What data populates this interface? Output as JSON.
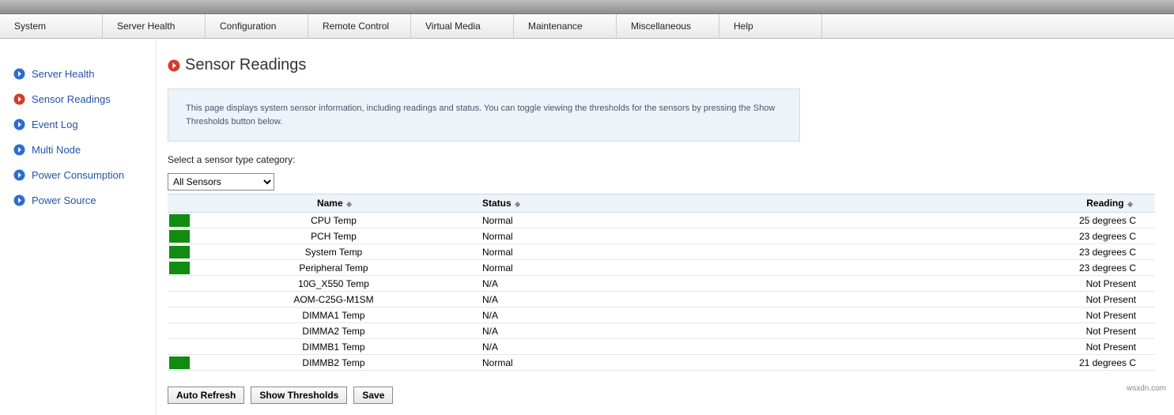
{
  "menubar": {
    "items": [
      {
        "label": "System"
      },
      {
        "label": "Server Health"
      },
      {
        "label": "Configuration"
      },
      {
        "label": "Remote Control"
      },
      {
        "label": "Virtual Media"
      },
      {
        "label": "Maintenance"
      },
      {
        "label": "Miscellaneous"
      },
      {
        "label": "Help"
      }
    ]
  },
  "sidebar": {
    "items": [
      {
        "label": "Server Health",
        "active": false
      },
      {
        "label": "Sensor Readings",
        "active": true
      },
      {
        "label": "Event Log",
        "active": false
      },
      {
        "label": "Multi Node",
        "active": false
      },
      {
        "label": "Power Consumption",
        "active": false
      },
      {
        "label": "Power Source",
        "active": false
      }
    ]
  },
  "page": {
    "title": "Sensor Readings",
    "info_text": "This page displays system sensor information, including readings and status. You can toggle viewing the thresholds for the sensors by pressing the Show Thresholds button below.",
    "select_label": "Select a sensor type category:",
    "select_value": "All Sensors"
  },
  "table": {
    "headers": {
      "name": "Name",
      "status": "Status",
      "reading": "Reading"
    },
    "rows": [
      {
        "swatch": "green",
        "name": "CPU Temp",
        "status": "Normal",
        "reading": "25 degrees C"
      },
      {
        "swatch": "green",
        "name": "PCH Temp",
        "status": "Normal",
        "reading": "23 degrees C"
      },
      {
        "swatch": "green",
        "name": "System Temp",
        "status": "Normal",
        "reading": "23 degrees C"
      },
      {
        "swatch": "green",
        "name": "Peripheral Temp",
        "status": "Normal",
        "reading": "23 degrees C"
      },
      {
        "swatch": "",
        "name": "10G_X550 Temp",
        "status": "N/A",
        "reading": "Not Present"
      },
      {
        "swatch": "",
        "name": "AOM-C25G-M1SM",
        "status": "N/A",
        "reading": "Not Present"
      },
      {
        "swatch": "",
        "name": "DIMMA1 Temp",
        "status": "N/A",
        "reading": "Not Present"
      },
      {
        "swatch": "",
        "name": "DIMMA2 Temp",
        "status": "N/A",
        "reading": "Not Present"
      },
      {
        "swatch": "",
        "name": "DIMMB1 Temp",
        "status": "N/A",
        "reading": "Not Present"
      },
      {
        "swatch": "green",
        "name": "DIMMB2 Temp",
        "status": "Normal",
        "reading": "21 degrees C"
      }
    ]
  },
  "buttons": {
    "auto_refresh": "Auto Refresh",
    "show_thresholds": "Show Thresholds",
    "save": "Save"
  },
  "footer": {
    "brand": "wsxdn.com"
  },
  "colors": {
    "swatch_green": "#118c11",
    "link_blue": "#2752a8",
    "info_bg": "#eef3fa"
  }
}
